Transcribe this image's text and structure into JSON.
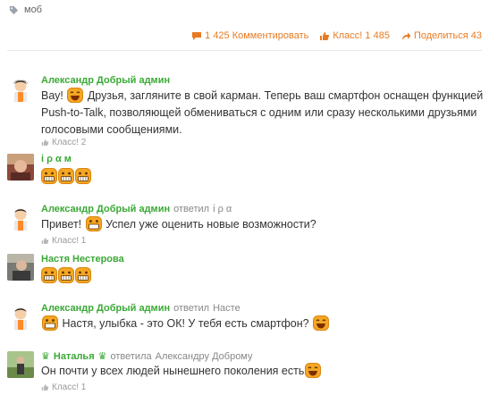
{
  "tag": {
    "label": "моб"
  },
  "actions": {
    "comment_label": "1 425 Комментировать",
    "like_label": "Класс! 1 485",
    "share_label": "Поделиться 43"
  },
  "comments": [
    {
      "author": "Александр Добрый админ",
      "text_before": "Вау!",
      "text_after": "Друзья, загляните в свой карман. Теперь ваш смартфон оснащен функцией Push-to-Talk, позволяющей обмениваться с одним или сразу несколькими друзьями голосовыми сообщениями.",
      "like_label": "Класс! 2"
    },
    {
      "author": "ἰ ρ α м"
    },
    {
      "author": "Александр Добрый админ",
      "replied_label": "ответил",
      "reply_to": "ἰ ρ α",
      "text_before": "Привет!",
      "text_after": "Успел уже оценить новые возможности?",
      "like_label": "Класс! 1"
    },
    {
      "author": "Настя Нестерова"
    },
    {
      "author": "Александр Добрый админ",
      "replied_label": "ответил",
      "reply_to": "Насте",
      "text_after": "Настя, улыбка - это ОК! У тебя есть смартфон?"
    },
    {
      "author": "Наталья",
      "replied_label": "ответила",
      "reply_to": "Александру Доброму",
      "text_before": "Он почти у всех людей нынешнего поколения есть",
      "like_label": "Класс! 1"
    }
  ],
  "colors": {
    "accent": "#e87b22",
    "author": "#3aa935",
    "text": "#333333",
    "muted": "#999999"
  }
}
